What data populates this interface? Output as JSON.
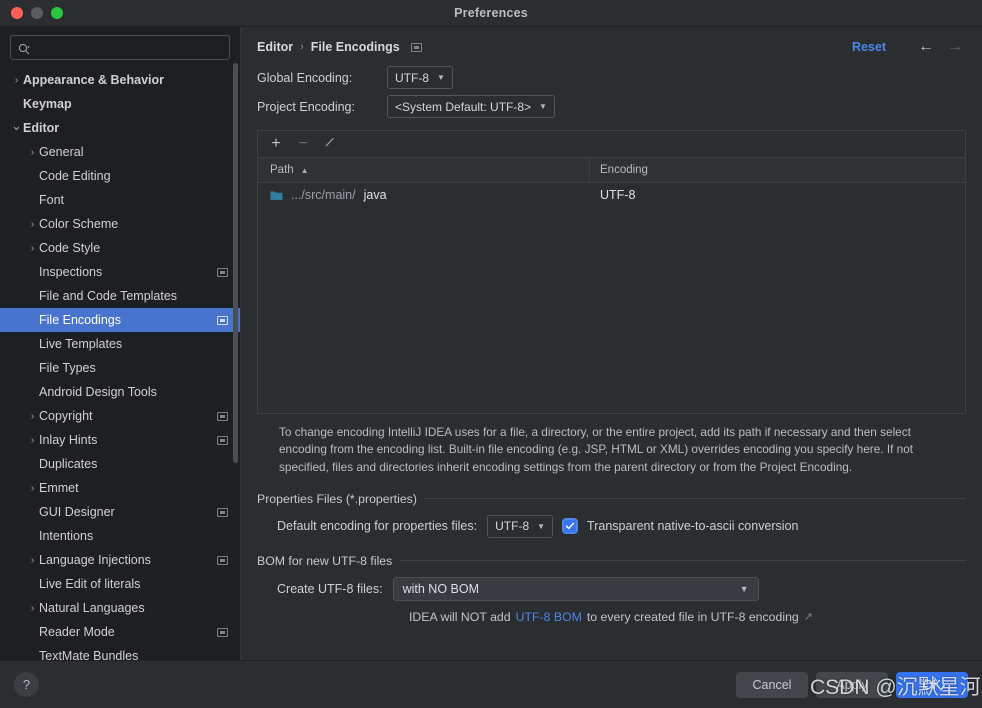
{
  "window": {
    "title": "Preferences",
    "traffic_lights": [
      "close",
      "minimize",
      "zoom"
    ]
  },
  "sidebar": {
    "search": {
      "value": "",
      "placeholder": ""
    },
    "items": [
      {
        "label": "Appearance & Behavior",
        "indent": 0,
        "arrow": "collapsed",
        "bold": true,
        "project_icon": false,
        "selected": false
      },
      {
        "label": "Keymap",
        "indent": 0,
        "arrow": "none",
        "bold": true,
        "project_icon": false,
        "selected": false
      },
      {
        "label": "Editor",
        "indent": 0,
        "arrow": "expanded",
        "bold": true,
        "project_icon": false,
        "selected": false
      },
      {
        "label": "General",
        "indent": 1,
        "arrow": "collapsed",
        "bold": false,
        "project_icon": false,
        "selected": false
      },
      {
        "label": "Code Editing",
        "indent": 1,
        "arrow": "none",
        "bold": false,
        "project_icon": false,
        "selected": false
      },
      {
        "label": "Font",
        "indent": 1,
        "arrow": "none",
        "bold": false,
        "project_icon": false,
        "selected": false
      },
      {
        "label": "Color Scheme",
        "indent": 1,
        "arrow": "collapsed",
        "bold": false,
        "project_icon": false,
        "selected": false
      },
      {
        "label": "Code Style",
        "indent": 1,
        "arrow": "collapsed",
        "bold": false,
        "project_icon": false,
        "selected": false
      },
      {
        "label": "Inspections",
        "indent": 1,
        "arrow": "none",
        "bold": false,
        "project_icon": true,
        "selected": false
      },
      {
        "label": "File and Code Templates",
        "indent": 1,
        "arrow": "none",
        "bold": false,
        "project_icon": false,
        "selected": false
      },
      {
        "label": "File Encodings",
        "indent": 1,
        "arrow": "none",
        "bold": false,
        "project_icon": true,
        "selected": true
      },
      {
        "label": "Live Templates",
        "indent": 1,
        "arrow": "none",
        "bold": false,
        "project_icon": false,
        "selected": false
      },
      {
        "label": "File Types",
        "indent": 1,
        "arrow": "none",
        "bold": false,
        "project_icon": false,
        "selected": false
      },
      {
        "label": "Android Design Tools",
        "indent": 1,
        "arrow": "none",
        "bold": false,
        "project_icon": false,
        "selected": false
      },
      {
        "label": "Copyright",
        "indent": 1,
        "arrow": "collapsed",
        "bold": false,
        "project_icon": true,
        "selected": false
      },
      {
        "label": "Inlay Hints",
        "indent": 1,
        "arrow": "collapsed",
        "bold": false,
        "project_icon": true,
        "selected": false
      },
      {
        "label": "Duplicates",
        "indent": 1,
        "arrow": "none",
        "bold": false,
        "project_icon": false,
        "selected": false
      },
      {
        "label": "Emmet",
        "indent": 1,
        "arrow": "collapsed",
        "bold": false,
        "project_icon": false,
        "selected": false
      },
      {
        "label": "GUI Designer",
        "indent": 1,
        "arrow": "none",
        "bold": false,
        "project_icon": true,
        "selected": false
      },
      {
        "label": "Intentions",
        "indent": 1,
        "arrow": "none",
        "bold": false,
        "project_icon": false,
        "selected": false
      },
      {
        "label": "Language Injections",
        "indent": 1,
        "arrow": "collapsed",
        "bold": false,
        "project_icon": true,
        "selected": false
      },
      {
        "label": "Live Edit of literals",
        "indent": 1,
        "arrow": "none",
        "bold": false,
        "project_icon": false,
        "selected": false
      },
      {
        "label": "Natural Languages",
        "indent": 1,
        "arrow": "collapsed",
        "bold": false,
        "project_icon": false,
        "selected": false
      },
      {
        "label": "Reader Mode",
        "indent": 1,
        "arrow": "none",
        "bold": false,
        "project_icon": true,
        "selected": false
      },
      {
        "label": "TextMate Bundles",
        "indent": 1,
        "arrow": "none",
        "bold": false,
        "project_icon": false,
        "selected": false
      }
    ]
  },
  "main": {
    "breadcrumb": {
      "parent": "Editor",
      "separator": "›",
      "current": "File Encodings"
    },
    "reset_label": "Reset",
    "nav_back": "←",
    "nav_forward": "→",
    "global_encoding": {
      "label": "Global Encoding:",
      "value": "UTF-8"
    },
    "project_encoding": {
      "label": "Project Encoding:",
      "value": "<System Default: UTF-8>"
    },
    "table": {
      "toolbar": {
        "add": "+",
        "remove": "−",
        "edit": "pencil-icon"
      },
      "columns": [
        "Path",
        "Encoding"
      ],
      "sort_column": "Path",
      "sort_direction": "asc",
      "rows": [
        {
          "path_dim": ".../src/main/",
          "path_strong": "java",
          "encoding": "UTF-8"
        }
      ]
    },
    "help_text": "To change encoding IntelliJ IDEA uses for a file, a directory, or the entire project, add its path if necessary and then select encoding from the encoding list. Built-in file encoding (e.g. JSP, HTML or XML) overrides encoding you specify here. If not specified, files and directories inherit encoding settings from the parent directory or from the Project Encoding.",
    "properties_group": {
      "title": "Properties Files (*.properties)",
      "default_encoding_label": "Default encoding for properties files:",
      "default_encoding_value": "UTF-8",
      "transparent_checkbox_label": "Transparent native-to-ascii conversion",
      "transparent_checked": true
    },
    "bom_group": {
      "title": "BOM for new UTF-8 files",
      "create_label": "Create UTF-8 files:",
      "create_value": "with NO BOM",
      "note_prefix": "IDEA will NOT add ",
      "note_link": "UTF-8 BOM",
      "note_suffix": " to every created file in UTF-8 encoding",
      "note_external_icon": "↗"
    }
  },
  "footer": {
    "help": "?",
    "cancel_label": "Cancel",
    "apply_label": "Apply",
    "ok_label": "OK"
  },
  "watermark": {
    "text": "CSDN @沉默星河"
  },
  "colors": {
    "accent_blue": "#3573f0",
    "link_blue": "#4a87e8",
    "selection_blue": "#4874cd",
    "window_bg": "#2b2d30",
    "sidebar_bg": "#1e1f22",
    "folder_teal": "#2f7f9c"
  }
}
